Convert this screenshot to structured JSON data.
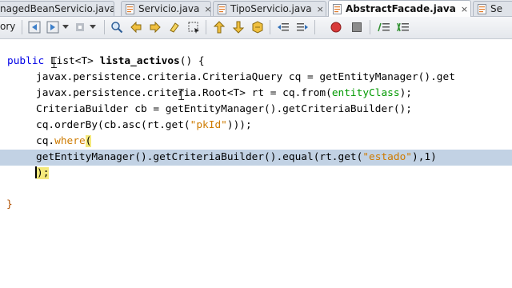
{
  "tabs": [
    {
      "label": "nagedBeanServicio.java",
      "close": "×",
      "active": false
    },
    {
      "label": "Servicio.java",
      "close": "×",
      "active": false
    },
    {
      "label": "TipoServicio.java",
      "close": "×",
      "active": false
    },
    {
      "label": "AbstractFacade.java",
      "close": "×",
      "active": true
    },
    {
      "label": "Se",
      "close": "",
      "active": false
    }
  ],
  "toolbar": {
    "history_label": "ory",
    "buttons": [
      "back-icon",
      "forward-icon",
      "dropdown-icon",
      "search-icon",
      "find-previous-icon",
      "find-next-icon",
      "toggle-highlight-icon",
      "rectangular-selection-icon",
      "previous-bookmark-icon",
      "next-bookmark-icon",
      "toggle-bookmark-icon",
      "shift-left-icon",
      "shift-right-icon",
      "record-macro-icon",
      "stop-macro-icon",
      "comment-icon",
      "uncomment-icon"
    ]
  },
  "editor": {
    "line1": {
      "kw": "public",
      "t1": " List<T> ",
      "method": "lista_activos",
      "t2": "() {"
    },
    "line2": "javax.persistence.criteria.CriteriaQuery cq = getEntityManager().get",
    "line3": {
      "t1": "javax.persistence.criteria.Root<T> rt = cq.from(",
      "field": "entityClass",
      "t2": ");"
    },
    "line4": "CriteriaBuilder cb = getEntityManager().getCriteriaBuilder();",
    "line5": {
      "t1": "cq.orderBy(cb.asc(rt.get(",
      "str": "\"pkId\"",
      "t2": ")));"
    },
    "line6": {
      "t1": "cq.",
      "method": "where",
      "paren": "("
    },
    "line7": {
      "t1": "getEntityManager().getCriteriaBuilder().equal(rt.get(",
      "str": "\"estado\"",
      "t2": "),1)"
    },
    "line8": ");",
    "closing_brace": "}"
  },
  "colors": {
    "keyword": "#0000e6",
    "string": "#ce7b00",
    "field": "#009900",
    "selection": "#c2d2e4",
    "match_highlight": "#f5e97b"
  }
}
